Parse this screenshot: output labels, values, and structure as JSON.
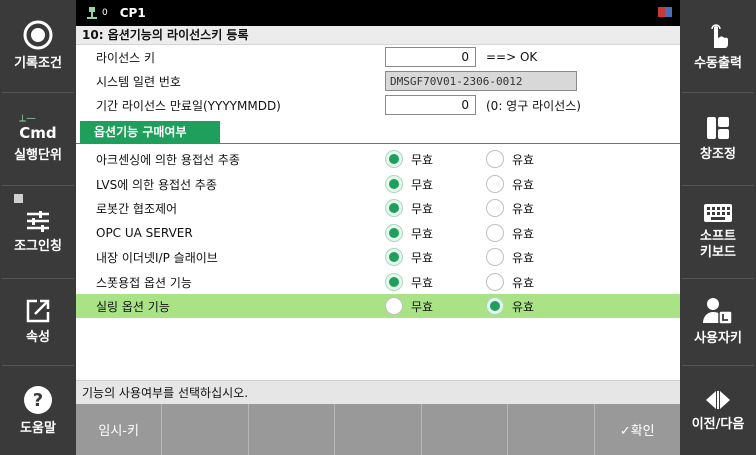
{
  "titlebar": {
    "status_text": "0",
    "program": "CP1"
  },
  "heading": "10: 옵션기능의 라이선스키 등록",
  "license": {
    "key_label": "라이선스 키",
    "key_value": "0",
    "key_hint": "==> OK",
    "serial_label": "시스템 일련 번호",
    "serial_value": "DMSGF70V01-2306-0012",
    "expiry_label": "기간 라이선스 만료일(YYYYMMDD)",
    "expiry_value": "0",
    "expiry_hint": "(0: 영구 라이선스)"
  },
  "section_title": "옵션기능 구매여부",
  "options": [
    {
      "label": "아크센싱에 의한 용접선 추종",
      "invalid": "무효",
      "valid": "유효",
      "selected": "무효"
    },
    {
      "label": "LVS에 의한 용접선 추종",
      "invalid": "무효",
      "valid": "유효",
      "selected": "무효"
    },
    {
      "label": "로봇간 협조제어",
      "invalid": "무효",
      "valid": "유효",
      "selected": "무효"
    },
    {
      "label": "OPC UA SERVER",
      "invalid": "무효",
      "valid": "유효",
      "selected": "무효"
    },
    {
      "label": "내장 이더넷I/P 슬래이브",
      "invalid": "무효",
      "valid": "유효",
      "selected": "무효"
    },
    {
      "label": "스폿용접 옵션 기능",
      "invalid": "무효",
      "valid": "유효",
      "selected": "무효"
    },
    {
      "label": "실링 옵션 기능",
      "invalid": "무효",
      "valid": "유효",
      "selected": "유효"
    }
  ],
  "status_message": "기능의 사용여부를 선택하십시오.",
  "softkeys": [
    "임시-키",
    "",
    "",
    "",
    "",
    "",
    "✓확인"
  ],
  "left_sidebar": [
    {
      "label": "기록조건",
      "icon": "record-icon"
    },
    {
      "label": "실행단위",
      "icon": "cmd-icon",
      "icon_text": "Cmd"
    },
    {
      "label": "조그인칭",
      "icon": "sliders-icon"
    },
    {
      "label": "속성",
      "icon": "edit-icon"
    },
    {
      "label": "도움말",
      "icon": "help-icon"
    }
  ],
  "right_sidebar": [
    {
      "label": "수동출력",
      "icon": "hand-icon"
    },
    {
      "label": "창조정",
      "icon": "window-icon"
    },
    {
      "label": "소프트\n키보드",
      "icon": "keyboard-icon"
    },
    {
      "label": "사용자키",
      "icon": "user-key-icon"
    },
    {
      "label": "이전/다음",
      "icon": "prev-next-icon"
    }
  ],
  "colors": {
    "accent": "#1e9f5c",
    "selected_row": "#a9e386",
    "sidebar": "#3a3a3a",
    "softkey": "#999999"
  }
}
